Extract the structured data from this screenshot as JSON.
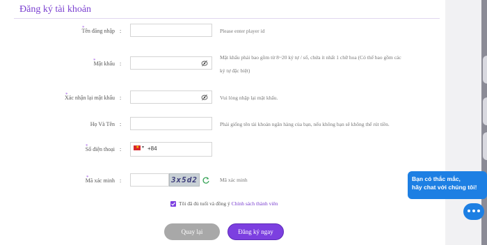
{
  "page": {
    "title": "Đăng ký tài khoản"
  },
  "form": {
    "fields": [
      {
        "label": "Tên đăng nhập",
        "colon": ":",
        "value": "",
        "hint": "Please enter player id",
        "required": true
      },
      {
        "label": "Mật khẩu",
        "colon": ":",
        "value": "",
        "hint_line1": "Mật khẩu phải bao gồm từ 8~20 ký tự / số, chứa ít nhất 1 chữ hoa (Có thể bao gồm các",
        "hint_line2": "ký tự đặc biệt)",
        "required": true
      },
      {
        "label": "Xác nhận lại mật khẩu",
        "colon": ":",
        "value": "",
        "hint": "Vui lòng nhập lại mật khẩu.",
        "required": true
      },
      {
        "label": "Họ Và Tên",
        "colon": ":",
        "value": "",
        "hint": "Phải giống tên tài khoản ngân hàng của bạn, nếu không bạn sẽ không thể rút tiền.",
        "required": false
      },
      {
        "label": "Số điện thoại",
        "colon": ":",
        "country_code": "+84",
        "flag_icon": "vietnam-flag-icon",
        "required": true
      },
      {
        "label": "Mã xác minh",
        "colon": ":",
        "value": "",
        "captcha_text": "3x5d2",
        "hint": "Mã xác minh",
        "required": true
      }
    ],
    "agree_text": "Tôi đã đủ tuổi và đồng ý",
    "agree_link": "Chính sách thành viên",
    "agree_checked": true,
    "back_button": "Quay lại",
    "register_button": "Đăng ký ngay"
  },
  "chat": {
    "line1": "Bạn có thắc mắc,",
    "line2": "hãy chat với chúng tôi!",
    "icon": "chat-icon"
  },
  "colors": {
    "accent": "#7c3fe0",
    "chat": "#1d7fe3",
    "back_button": "#a8a8a8"
  }
}
